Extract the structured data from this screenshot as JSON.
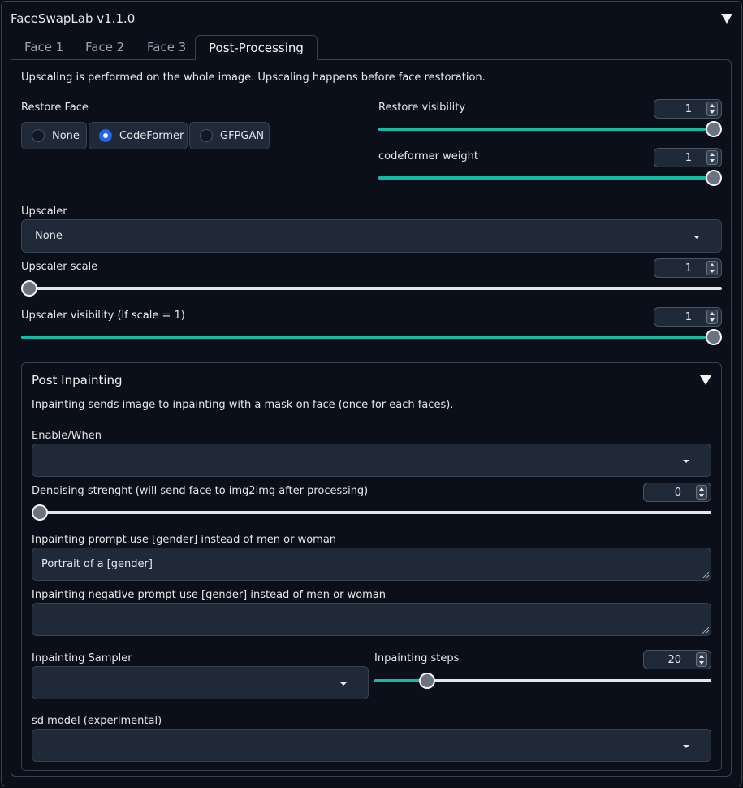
{
  "app": {
    "title": "FaceSwapLab v1.1.0"
  },
  "tabs": [
    {
      "label": "Face 1"
    },
    {
      "label": "Face 2"
    },
    {
      "label": "Face 3"
    },
    {
      "label": "Post-Processing"
    }
  ],
  "active_tab": "Post-Processing",
  "info_text": "Upscaling is performed on the whole image. Upscaling happens before face restoration.",
  "restore_face": {
    "label": "Restore Face",
    "options": [
      "None",
      "CodeFormer",
      "GFPGAN"
    ],
    "selected": "CodeFormer"
  },
  "restore_visibility": {
    "label": "Restore visibility",
    "value": "1",
    "fraction": 1.0
  },
  "codeformer_weight": {
    "label": "codeformer weight",
    "value": "1",
    "fraction": 1.0
  },
  "upscaler": {
    "label": "Upscaler",
    "value": "None"
  },
  "upscaler_scale": {
    "label": "Upscaler scale",
    "value": "1",
    "fraction": 0.0
  },
  "upscaler_visibility": {
    "label": "Upscaler visibility (if scale = 1)",
    "value": "1",
    "fraction": 1.0
  },
  "post_inpainting": {
    "title": "Post Inpainting",
    "info": "Inpainting sends image to inpainting with a mask on face (once for each faces).",
    "enable_when": {
      "label": "Enable/When",
      "value": ""
    },
    "denoising": {
      "label": "Denoising strenght (will send face to img2img after processing)",
      "value": "0",
      "fraction": 0.0
    },
    "prompt": {
      "label": "Inpainting prompt use [gender] instead of men or woman",
      "value": "Portrait of a [gender]"
    },
    "negative_prompt": {
      "label": "Inpainting negative prompt use [gender] instead of men or woman",
      "value": ""
    },
    "sampler": {
      "label": "Inpainting Sampler",
      "value": ""
    },
    "steps": {
      "label": "Inpainting steps",
      "value": "20",
      "fraction": 0.14
    },
    "sd_model": {
      "label": "sd model (experimental)",
      "value": ""
    }
  },
  "colors": {
    "accent": "#14b8a6",
    "radio_selected": "#2563eb",
    "background": "#0b0f19",
    "input_bg": "#1f2937"
  }
}
